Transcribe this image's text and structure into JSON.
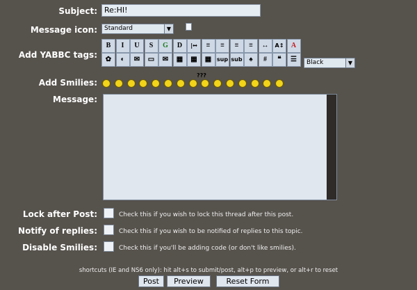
{
  "form": {
    "subject_label": "Subject:",
    "subject_value": "Re:HI!",
    "message_icon_label": "Message icon:",
    "message_icon_selected": "Standard",
    "yabbc_label": "Add YABBC tags:",
    "color_selected": "Black",
    "smilies_label": "Add Smilies:",
    "message_label": "Message:"
  },
  "toolbar": [
    {
      "text": "B",
      "icon": "bold-icon"
    },
    {
      "text": "I",
      "icon": "italic-icon"
    },
    {
      "text": "U",
      "icon": "underline-icon"
    },
    {
      "text": "S",
      "icon": "strike-icon"
    },
    {
      "text": "G",
      "icon": "glow-icon"
    },
    {
      "text": "D",
      "icon": "shadow-icon"
    },
    {
      "text": "|↔",
      "icon": "move-icon"
    },
    {
      "text": "≡",
      "icon": "preformatted-icon"
    },
    {
      "text": "≡",
      "icon": "align-left-icon"
    },
    {
      "text": "≡",
      "icon": "center-icon"
    },
    {
      "text": "≡",
      "icon": "align-right-icon"
    },
    {
      "text": "↔",
      "icon": "horizontal-rule-icon"
    },
    {
      "text": "A↕",
      "icon": "font-size-icon"
    },
    {
      "text": "A",
      "icon": "font-face-icon"
    },
    {
      "text": "✿",
      "icon": "flash-icon"
    },
    {
      "text": "◐",
      "icon": "hyperlink-icon"
    },
    {
      "text": "✉",
      "icon": "ftp-icon"
    },
    {
      "text": "▭",
      "icon": "image-icon"
    },
    {
      "text": "✉",
      "icon": "email-icon"
    },
    {
      "text": "▦",
      "icon": "table-icon"
    },
    {
      "text": "▦",
      "icon": "table-row-icon"
    },
    {
      "text": "▦",
      "icon": "table-column-icon"
    },
    {
      "text": "sup",
      "icon": "superscript-icon"
    },
    {
      "text": "sub",
      "icon": "subscript-icon"
    },
    {
      "text": "♠",
      "icon": "teletype-icon"
    },
    {
      "text": "#",
      "icon": "code-icon"
    },
    {
      "text": "❝",
      "icon": "quote-icon"
    },
    {
      "text": "☰",
      "icon": "list-icon"
    }
  ],
  "smilies_extra": "???",
  "options": [
    {
      "label": "Lock after Post:",
      "hint": "Check this if you wish to lock this thread after this post."
    },
    {
      "label": "Notify of replies:",
      "hint": "Check this if you wish to be notified of replies to this topic."
    },
    {
      "label": "Disable Smilies:",
      "hint": "Check this if you'll be adding code (or don't like smilies)."
    }
  ],
  "shortcuts": "shortcuts (IE and NS6 only): hit alt+s to submit/post, alt+p to preview, or alt+r to reset",
  "buttons": {
    "post": "Post",
    "preview": "Preview",
    "reset": "Reset Form"
  },
  "colors": {
    "background": "#56524c",
    "field": "#e0e7ef",
    "smiley": "#f2d41a"
  }
}
